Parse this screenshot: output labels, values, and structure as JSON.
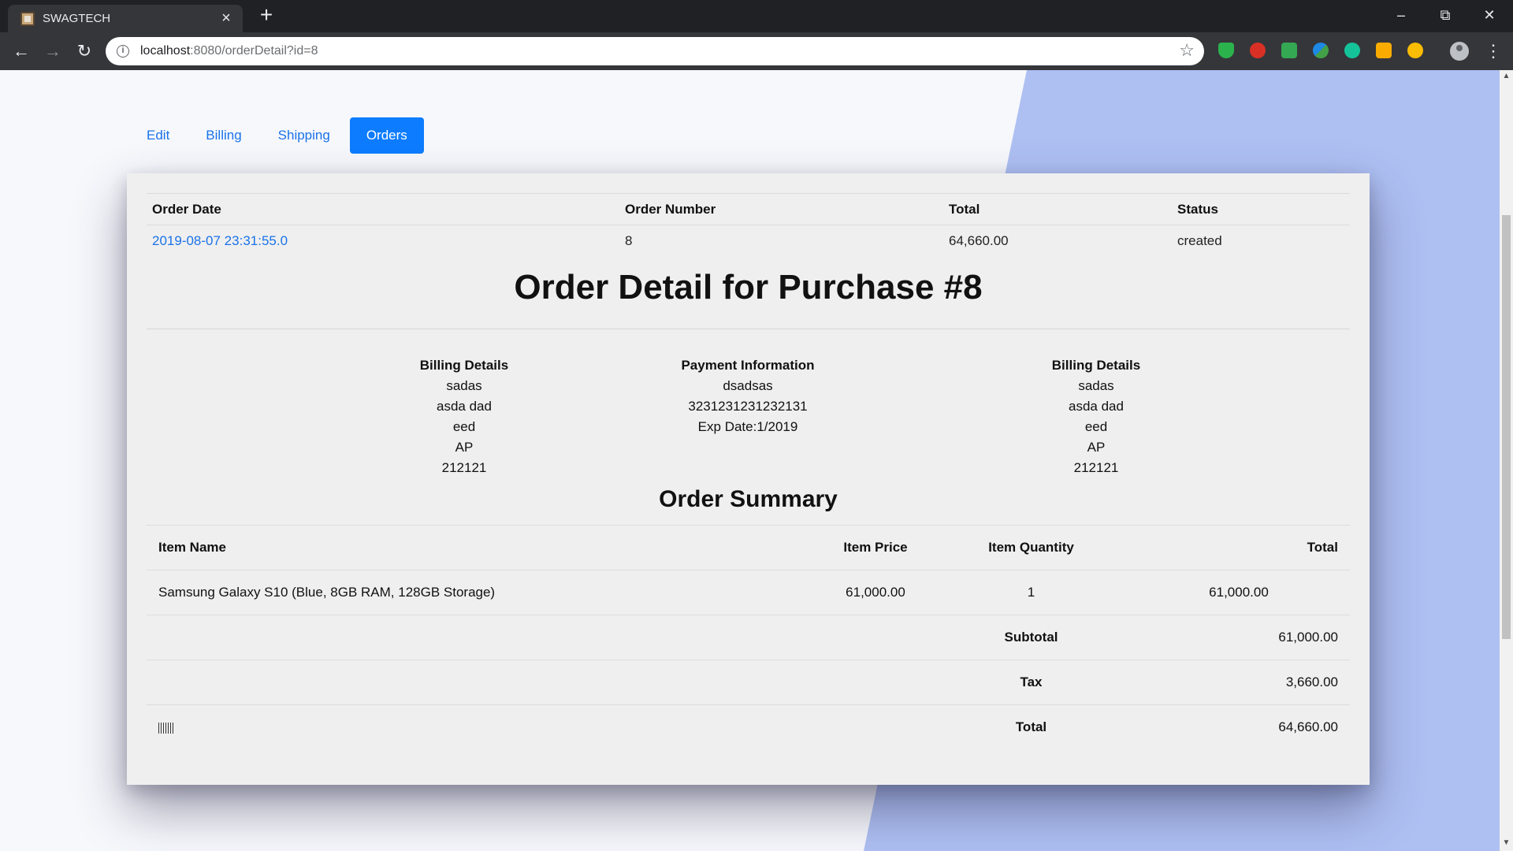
{
  "browser": {
    "tab_title": "SWAGTECH",
    "url_host": "localhost",
    "url_rest": ":8080/orderDetail?id=8"
  },
  "tabs": [
    "Edit",
    "Billing",
    "Shipping",
    "Orders"
  ],
  "active_tab": "Orders",
  "orders": {
    "headers": [
      "Order Date",
      "Order Number",
      "Total",
      "Status"
    ],
    "row": {
      "date": "2019-08-07 23:31:55.0",
      "number": "8",
      "total": "64,660.00",
      "status": "created"
    }
  },
  "detail": {
    "title": "Order Detail for Purchase #8",
    "billing": {
      "heading": "Billing Details",
      "name": "sadas",
      "street": "asda dad",
      "city": "eed",
      "state": "AP",
      "zip": "212121"
    },
    "payment": {
      "heading": "Payment Information",
      "card_name": "dsadsas",
      "card_number": "3231231231232131",
      "expiry": "Exp Date:1/2019"
    },
    "shipping": {
      "heading": "Billing Details",
      "name": "sadas",
      "street": "asda dad",
      "city": "eed",
      "state": "AP",
      "zip": "212121"
    }
  },
  "summary": {
    "title": "Order Summary",
    "headers": {
      "item_name": "Item Name",
      "item_price": "Item Price",
      "item_quantity": "Item Quantity",
      "total": "Total"
    },
    "item": {
      "name": "Samsung Galaxy S10 (Blue, 8GB RAM, 128GB Storage)",
      "price": "61,000.00",
      "quantity": "1",
      "total": "61,000.00"
    },
    "subtotal_label": "Subtotal",
    "subtotal": "61,000.00",
    "tax_label": "Tax",
    "tax": "3,660.00",
    "total_label": "Total",
    "total": "64,660.00"
  },
  "colors": {
    "accent": "#0d7cff",
    "link": "#1a73e8",
    "background_shape": "#aebff2"
  }
}
